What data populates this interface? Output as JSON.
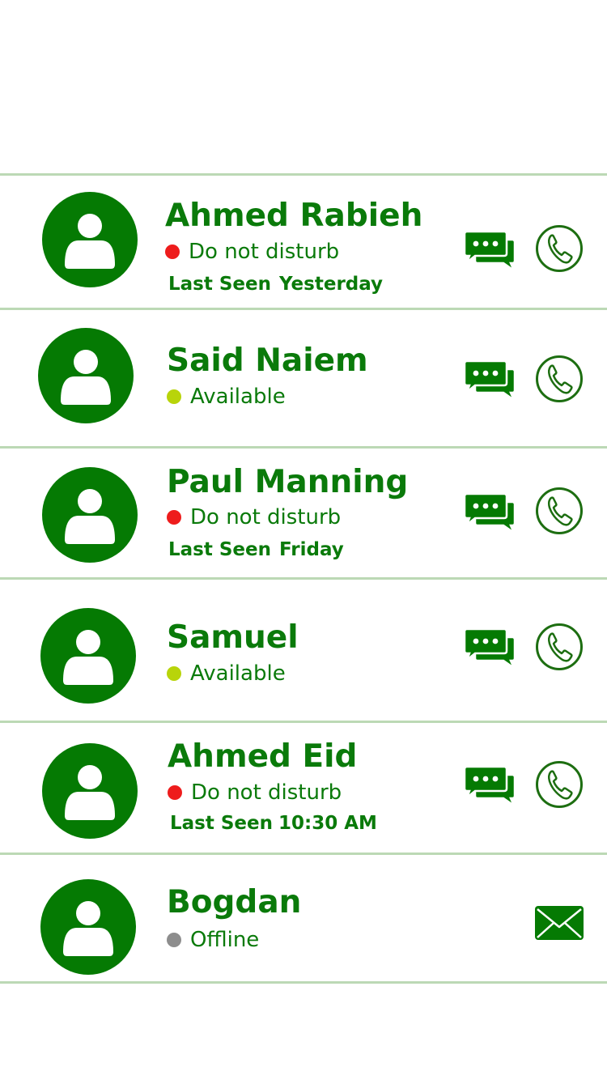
{
  "colors": {
    "brand_green": "#057a03",
    "divider": "#bcd9b5",
    "status_busy": "#ee1c1c",
    "status_available": "#b8d40a",
    "status_offline": "#8d8d8d"
  },
  "contacts": [
    {
      "name": "Ahmed Rabieh",
      "status": "Do not disturb",
      "status_color": "#ee1c1c",
      "last_seen_label": "Last Seen",
      "last_seen_value": "Yesterday",
      "actions": [
        "chat-icon",
        "phone-icon"
      ]
    },
    {
      "name": "Said Naiem",
      "status": "Available",
      "status_color": "#b8d40a",
      "actions": [
        "chat-icon",
        "phone-icon"
      ]
    },
    {
      "name": "Paul Manning",
      "status": "Do not disturb",
      "status_color": "#ee1c1c",
      "last_seen_label": "Last Seen",
      "last_seen_value": "Friday",
      "actions": [
        "chat-icon",
        "phone-icon"
      ]
    },
    {
      "name": "Samuel",
      "status": "Available",
      "status_color": "#b8d40a",
      "actions": [
        "chat-icon",
        "phone-icon"
      ]
    },
    {
      "name": "Ahmed Eid",
      "status": "Do not disturb",
      "status_color": "#ee1c1c",
      "last_seen_label": "Last Seen",
      "last_seen_value": "10:30 AM",
      "actions": [
        "chat-icon",
        "phone-icon"
      ]
    },
    {
      "name": "Bogdan",
      "status": "Offline",
      "status_color": "#8d8d8d",
      "actions": [
        "mail-icon"
      ]
    }
  ]
}
